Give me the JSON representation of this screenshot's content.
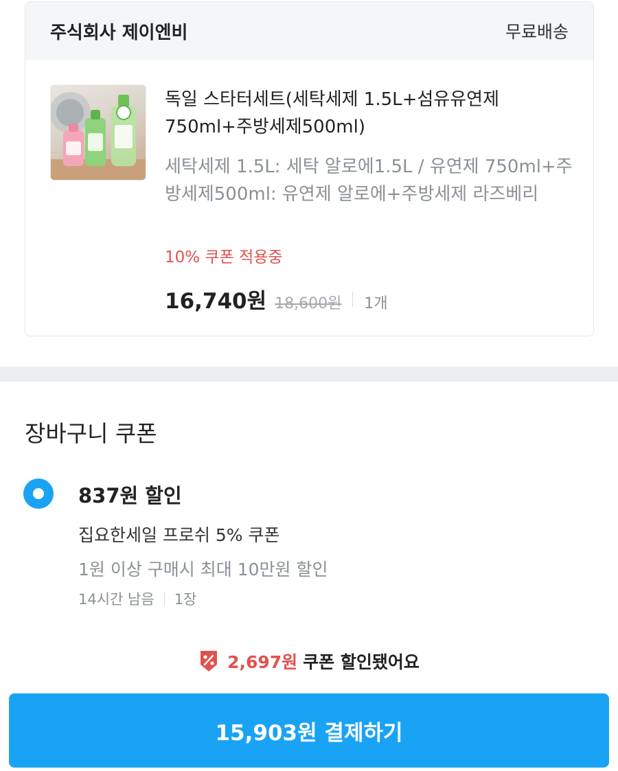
{
  "seller": {
    "name": "주식회사 제이엔비",
    "shipping": "무료배송"
  },
  "product": {
    "thumbnail_icon": "detergent-set-image",
    "title": "독일 스타터세트(세탁세제 1.5L+섬유유연제 750ml+주방세제500ml)",
    "option": "세탁세제 1.5L: 세탁 알로에1.5L / 유연제 750ml+주방세제500ml: 유연제 알로에+주방세제 라즈베리",
    "coupon_status": "10% 쿠폰 적용중",
    "price": "16,740원",
    "original_price": "18,600원",
    "quantity": "1개"
  },
  "cart_coupon": {
    "section_title": "장바구니 쿠폰",
    "selected": true,
    "discount": "837원 할인",
    "name": "집요한세일 프로쉬 5% 쿠폰",
    "condition": "1원 이상 구매시 최대 10만원 할인",
    "time_left": "14시간 남음",
    "count": "1장"
  },
  "summary": {
    "saved_amount": "2,697원",
    "saved_text": "쿠폰 할인됐어요",
    "pay_label": "15,903원 결제하기"
  },
  "colors": {
    "accent": "#1aa3f5",
    "discount_red": "#e0524f",
    "muted_text": "#8a9096"
  }
}
